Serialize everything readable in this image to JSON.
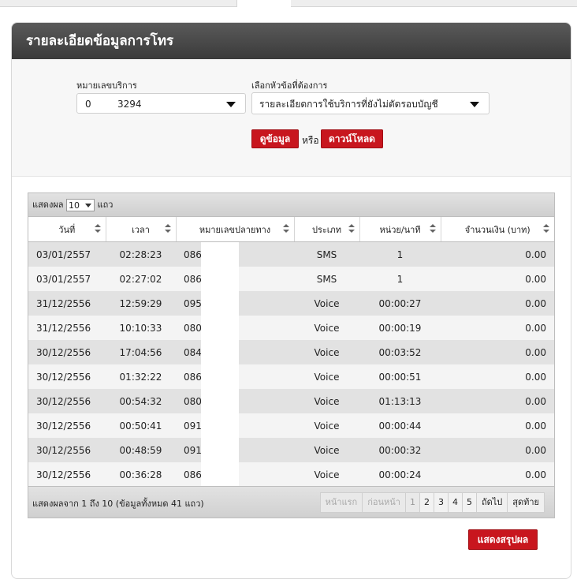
{
  "panel": {
    "title": "รายละเอียดข้อมูลการโทร"
  },
  "filter": {
    "service_label": "หมายเลขบริการ",
    "service_value_prefix": "0",
    "service_value_suffix": "3294",
    "topic_label": "เลือกหัวข้อที่ต้องการ",
    "topic_value": "รายละเอียดการใช้บริการที่ยังไม่ตัดรอบบัญชี",
    "view_button": "ดูข้อมูล",
    "or_text": "หรือ",
    "download_button": "ดาวน์โหลด"
  },
  "grid": {
    "show_label": "แสดงผล",
    "page_length": "10",
    "rows_label": "แถว",
    "columns": [
      "วันที่",
      "เวลา",
      "หมายเลขปลายทาง",
      "ประเภท",
      "หน่วย/นาที",
      "จำนวนเงิน (บาท)"
    ],
    "rows": [
      {
        "date": "03/01/2557",
        "time": "02:28:23",
        "number": "086",
        "type": "SMS",
        "unit": "1",
        "amount": "0.00"
      },
      {
        "date": "03/01/2557",
        "time": "02:27:02",
        "number": "086",
        "type": "SMS",
        "unit": "1",
        "amount": "0.00"
      },
      {
        "date": "31/12/2556",
        "time": "12:59:29",
        "number": "095",
        "type": "Voice",
        "unit": "00:00:27",
        "amount": "0.00"
      },
      {
        "date": "31/12/2556",
        "time": "10:10:33",
        "number": "080",
        "type": "Voice",
        "unit": "00:00:19",
        "amount": "0.00"
      },
      {
        "date": "30/12/2556",
        "time": "17:04:56",
        "number": "084",
        "type": "Voice",
        "unit": "00:03:52",
        "amount": "0.00"
      },
      {
        "date": "30/12/2556",
        "time": "01:32:22",
        "number": "086",
        "type": "Voice",
        "unit": "00:00:51",
        "amount": "0.00"
      },
      {
        "date": "30/12/2556",
        "time": "00:54:32",
        "number": "080",
        "type": "Voice",
        "unit": "01:13:13",
        "amount": "0.00"
      },
      {
        "date": "30/12/2556",
        "time": "00:50:41",
        "number": "091",
        "type": "Voice",
        "unit": "00:00:44",
        "amount": "0.00"
      },
      {
        "date": "30/12/2556",
        "time": "00:48:59",
        "number": "091",
        "type": "Voice",
        "unit": "00:00:32",
        "amount": "0.00"
      },
      {
        "date": "30/12/2556",
        "time": "00:36:28",
        "number": "086",
        "type": "Voice",
        "unit": "00:00:24",
        "amount": "0.00"
      }
    ],
    "info": "แสดงผลจาก 1 ถึง 10 (ข้อมูลทั้งหมด 41 แถว)",
    "pager": {
      "first": "หน้าแรก",
      "prev": "ก่อนหน้า",
      "pages": [
        "1",
        "2",
        "3",
        "4",
        "5"
      ],
      "next": "ถัดไป",
      "last": "สุดท้าย"
    }
  },
  "summary_button": "แสดงสรุปผล",
  "colors": {
    "header_dark": "#3a3a3a",
    "accent_red": "#c8161e"
  }
}
